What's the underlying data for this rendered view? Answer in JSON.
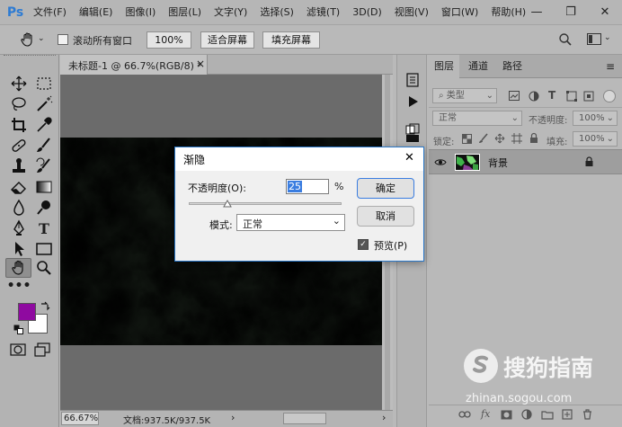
{
  "app": {
    "logo": "Ps"
  },
  "menu": [
    "文件(F)",
    "编辑(E)",
    "图像(I)",
    "图层(L)",
    "文字(Y)",
    "选择(S)",
    "滤镜(T)",
    "3D(D)",
    "视图(V)",
    "窗口(W)",
    "帮助(H)"
  ],
  "window_controls": {
    "minimize": "—",
    "restore": "❐",
    "close": "✕"
  },
  "options": {
    "scroll_all_label": "滚动所有窗口",
    "zoom_100": "100%",
    "fit_screen": "适合屏幕",
    "fill_screen": "填充屏幕"
  },
  "document": {
    "tab_title": "未标题-1 @ 66.7%(RGB/8) *",
    "tab_close": "×",
    "zoom": "66.67%",
    "doc_info": "文档:937.5K/937.5K"
  },
  "colors": {
    "foreground": "#8f0aa0",
    "background": "#ffffff",
    "dialog_border": "#2b78c8"
  },
  "layers_panel": {
    "tabs": [
      "图层",
      "通道",
      "路径"
    ],
    "filter_kind": "类型",
    "blend_mode": "正常",
    "opacity_label": "不透明度:",
    "opacity_value": "100%",
    "lock_label": "锁定:",
    "fill_label": "填充:",
    "fill_value": "100%",
    "layer_name": "背景",
    "bottom_icons": [
      "link-icon",
      "fx-icon",
      "mask-icon",
      "adjustment-icon",
      "group-icon",
      "new-layer-icon",
      "trash-icon"
    ],
    "fx_label": "fx"
  },
  "fade_dialog": {
    "title": "渐隐",
    "close": "✕",
    "opacity_label": "不透明度(O):",
    "opacity_value": "25",
    "percent": "%",
    "opacity_fraction": 0.25,
    "mode_label": "模式:",
    "mode_value": "正常",
    "ok": "确定",
    "cancel": "取消",
    "preview_label": "预览(P)",
    "preview_checked": true
  },
  "watermark": {
    "brand": "搜狗指南",
    "url": "zhinan.sogou.com"
  }
}
